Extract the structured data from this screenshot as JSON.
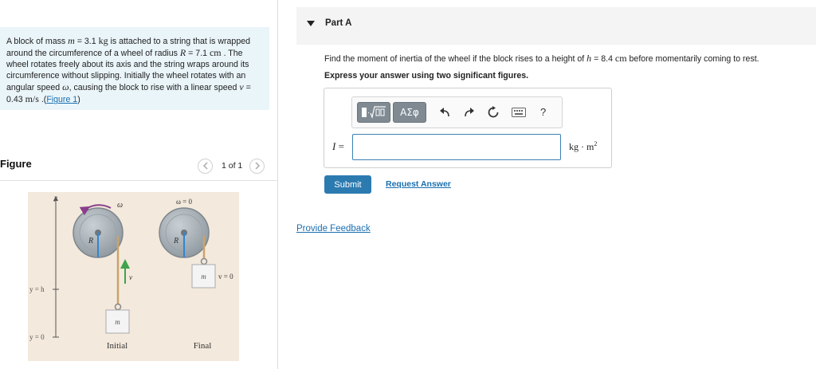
{
  "problem": {
    "t1": "A block of mass ",
    "m_sym": "m",
    "t2": " = 3.1 ",
    "m_unit": "kg",
    "t3": " is attached to a string that is wrapped around the circumference of a wheel of radius ",
    "r_sym": "R",
    "t4": " = 7.1 ",
    "r_unit": "cm",
    "t5": " . The wheel rotates freely about its axis and the string wraps around its circumference without slipping. Initially the wheel rotates with an angular speed ",
    "w_sym": "ω",
    "t6": ", causing the block to rise with a linear speed ",
    "v_sym": "v",
    "t7": " = 0.43 ",
    "v_unit": "m/s",
    "t8": " .(",
    "figure_link": "Figure 1",
    "t9": ")"
  },
  "figure": {
    "title": "Figure",
    "counter": "1 of 1",
    "labels": {
      "y_axis": "y",
      "y_h": "y = h",
      "y_0": "y = 0",
      "omega": "ω",
      "omega_zero": "ω = 0",
      "radius_left": "R",
      "radius_right": "R",
      "v": "v",
      "v_zero": "v = 0",
      "mass_left": "m",
      "mass_right": "m",
      "initial": "Initial",
      "final": "Final"
    },
    "colors": {
      "background": "#f3e9dc",
      "wheel": "#a9b2b9",
      "wheel_rim": "#7d868d",
      "radius_line": "#2f86d1",
      "arrow_green": "#3fa34d",
      "arrow_purple": "#8a3e8c",
      "rope": "#c9a46a",
      "block": "#f4f4f4"
    }
  },
  "part": {
    "title": "Part A",
    "q1": "Find the moment of inertia of the wheel if the block rises to a height of ",
    "h_sym": "h",
    "q2": " = 8.4 ",
    "h_unit": "cm",
    "q3": " before momentarily coming to rest.",
    "instruction": "Express your answer using two significant figures."
  },
  "answer": {
    "var_sym": "I",
    "eq": " =",
    "value": "",
    "unit_base": "kg · m",
    "unit_exp": "2"
  },
  "toolbar": {
    "templates_icon": "fraction-sqrt-icon",
    "greek_label": "ΑΣφ",
    "undo_icon": "undo-icon",
    "redo_icon": "redo-icon",
    "reset_icon": "reset-icon",
    "keyboard_icon": "keyboard-icon",
    "help_label": "?"
  },
  "actions": {
    "submit": "Submit",
    "request": "Request Answer",
    "feedback": "Provide Feedback"
  }
}
